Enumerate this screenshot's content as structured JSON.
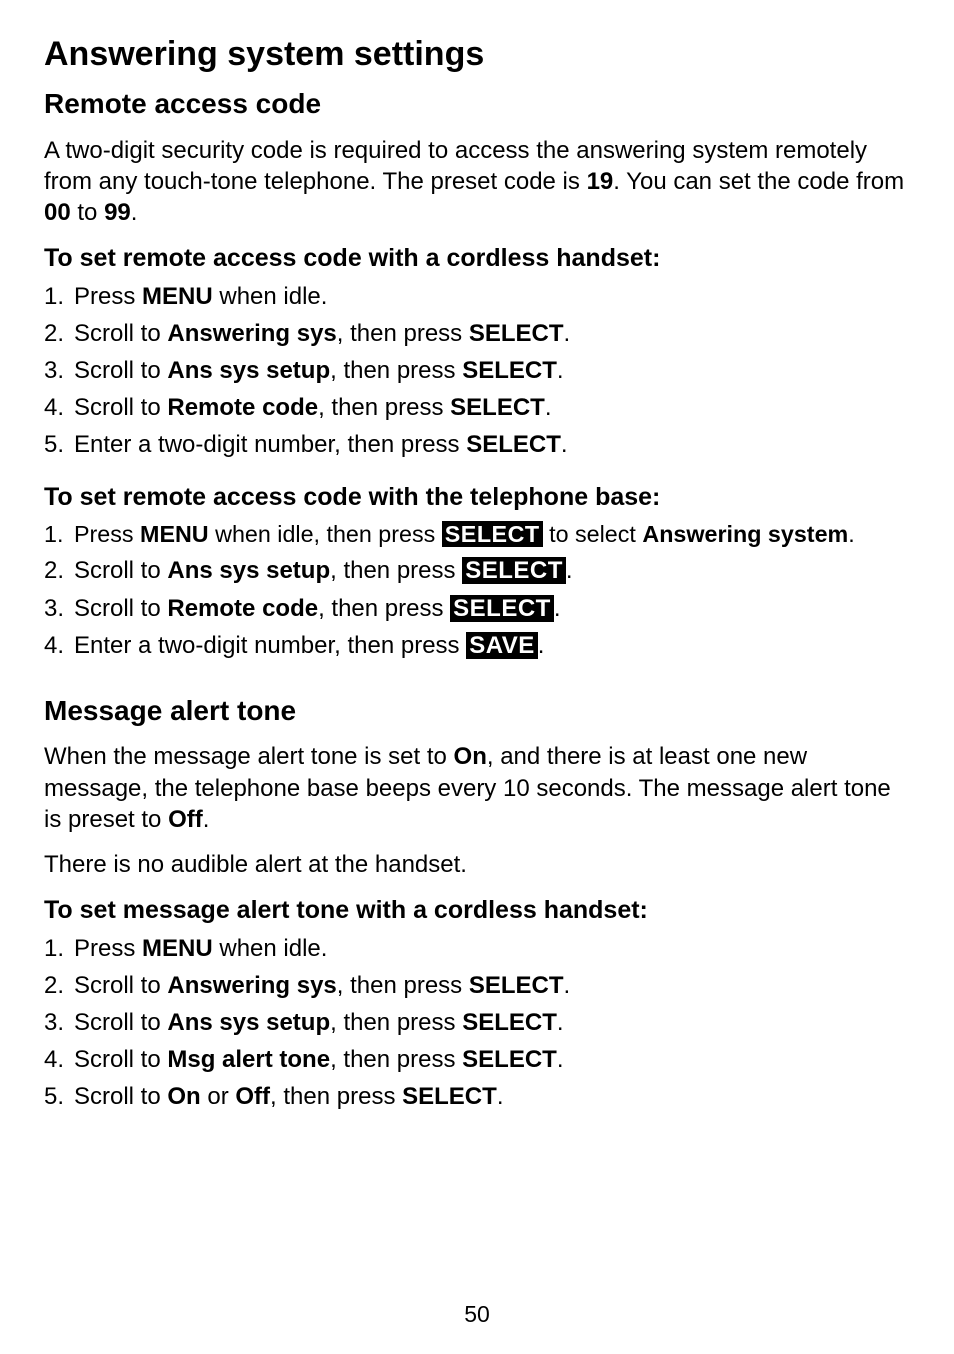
{
  "page_title": "Answering system settings",
  "s1": {
    "heading": "Remote access code",
    "intro_pre": "A two-digit security code is required to access the answering system remotely from any touch-tone telephone. The preset code is ",
    "intro_b1": "19",
    "intro_mid": ". You can set the code from ",
    "intro_b2": "00",
    "intro_to": " to ",
    "intro_b3": "99",
    "intro_end": ".",
    "handset_heading": "To set remote access code with a cordless handset:",
    "h_steps": [
      {
        "a": "Press ",
        "b": "MENU",
        "c": " when idle."
      },
      {
        "a": "Scroll to ",
        "b": "Answering sys",
        "c": ", then press ",
        "d": "SELECT",
        "e": "."
      },
      {
        "a": "Scroll to ",
        "b": "Ans sys setup",
        "c": ", then press ",
        "d": "SELECT",
        "e": "."
      },
      {
        "a": "Scroll to ",
        "b": "Remote code",
        "c": ", then press ",
        "d": "SELECT",
        "e": "."
      },
      {
        "a": "Enter a two-digit number, then press ",
        "b": "SELECT",
        "c": "."
      }
    ],
    "base_heading": "To set remote access code with the telephone base:",
    "b_steps": {
      "s1": {
        "a": "Press ",
        "b": "MENU",
        "c": " when idle, then press ",
        "inv": "SELECT",
        "e": " to select ",
        "f": "Answering system",
        "g": "."
      },
      "s2": {
        "a": "Scroll to ",
        "b": "Ans sys setup",
        "c": ", then press ",
        "inv": "SELECT",
        "e": "."
      },
      "s3": {
        "a": "Scroll to ",
        "b": "Remote code",
        "c": ", then press ",
        "inv": "SELECT",
        "e": "."
      },
      "s4": {
        "a": "Enter a two-digit number, then press ",
        "inv": "SAVE",
        "e": "."
      }
    }
  },
  "s2": {
    "heading": "Message alert tone",
    "p1_a": "When the message alert tone is set to ",
    "p1_b": "On",
    "p1_c": ", and there is at least one new message, the telephone base beeps every 10 seconds. The message alert tone is preset to ",
    "p1_d": "Off",
    "p1_e": ".",
    "p2": "There is no audible alert at the handset.",
    "handset_heading": "To set message alert tone with a cordless handset:",
    "h_steps": [
      {
        "a": "Press ",
        "b": "MENU",
        "c": " when idle."
      },
      {
        "a": "Scroll to ",
        "b": "Answering sys",
        "c": ", then press ",
        "d": "SELECT",
        "e": "."
      },
      {
        "a": "Scroll to ",
        "b": "Ans sys setup",
        "c": ", then press ",
        "d": "SELECT",
        "e": "."
      },
      {
        "a": "Scroll to ",
        "b": "Msg alert tone",
        "c": ", then press ",
        "d": "SELECT",
        "e": "."
      },
      {
        "a": "Scroll to ",
        "b": "On",
        "c": " or ",
        "d": "Off",
        "e": ", then press ",
        "f": "SELECT",
        "g": "."
      }
    ]
  },
  "page_number": "50"
}
